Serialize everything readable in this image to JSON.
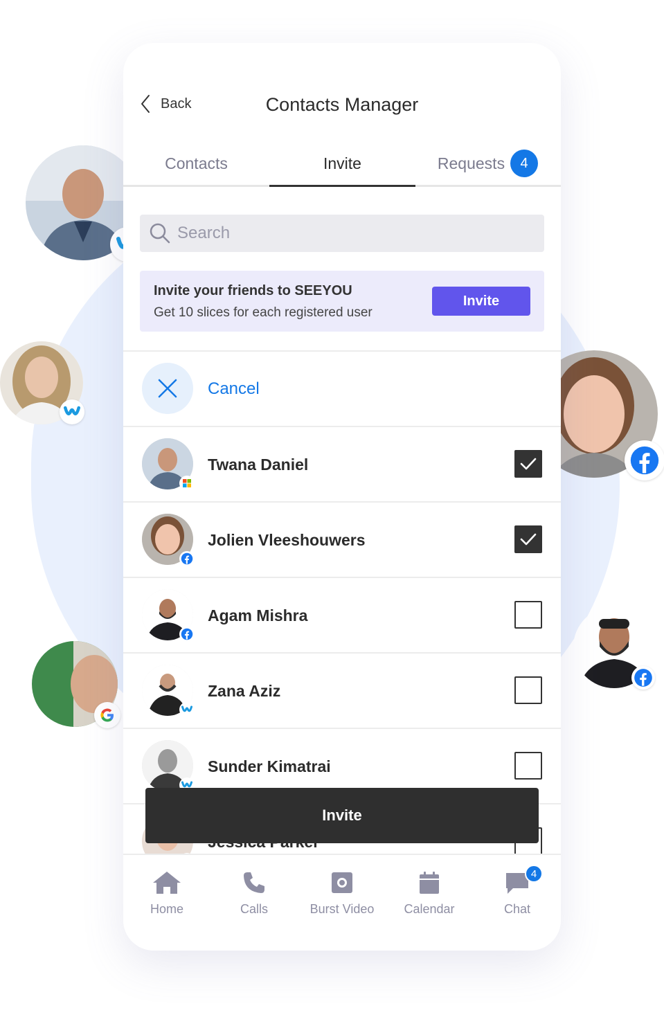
{
  "header": {
    "back_label": "Back",
    "title": "Contacts Manager"
  },
  "tabs": [
    {
      "label": "Contacts"
    },
    {
      "label": "Invite",
      "active": true
    },
    {
      "label": "Requests",
      "badge": "4"
    }
  ],
  "search": {
    "placeholder": "Search"
  },
  "promo": {
    "title": "Invite your friends to SEEYOU",
    "subtitle": "Get 10 slices for each registered user",
    "button": "Invite"
  },
  "cancel_label": "Cancel",
  "contacts": [
    {
      "name": "Twana Daniel",
      "checked": true,
      "source": "microsoft-icon"
    },
    {
      "name": "Jolien Vleeshouwers",
      "checked": true,
      "source": "facebook-icon"
    },
    {
      "name": "Agam Mishra",
      "checked": false,
      "source": "facebook-icon"
    },
    {
      "name": "Zana Aziz",
      "checked": false,
      "source": "webex-icon"
    },
    {
      "name": "Sunder Kimatrai",
      "checked": false,
      "source": "webex-icon"
    },
    {
      "name": "Jessica Parker",
      "checked": false,
      "source": "google-icon"
    }
  ],
  "invite_button": "Invite",
  "nav": [
    {
      "label": "Home",
      "icon": "home-icon"
    },
    {
      "label": "Calls",
      "icon": "phone-icon"
    },
    {
      "label": "Burst Video",
      "icon": "camera-icon"
    },
    {
      "label": "Calendar",
      "icon": "calendar-icon"
    },
    {
      "label": "Chat",
      "icon": "chat-icon",
      "badge": "4"
    }
  ],
  "colors": {
    "accent": "#1478e6",
    "promo_button": "#6155ec",
    "dark": "#2f2f2f",
    "promo_bg": "#ecebfb"
  }
}
